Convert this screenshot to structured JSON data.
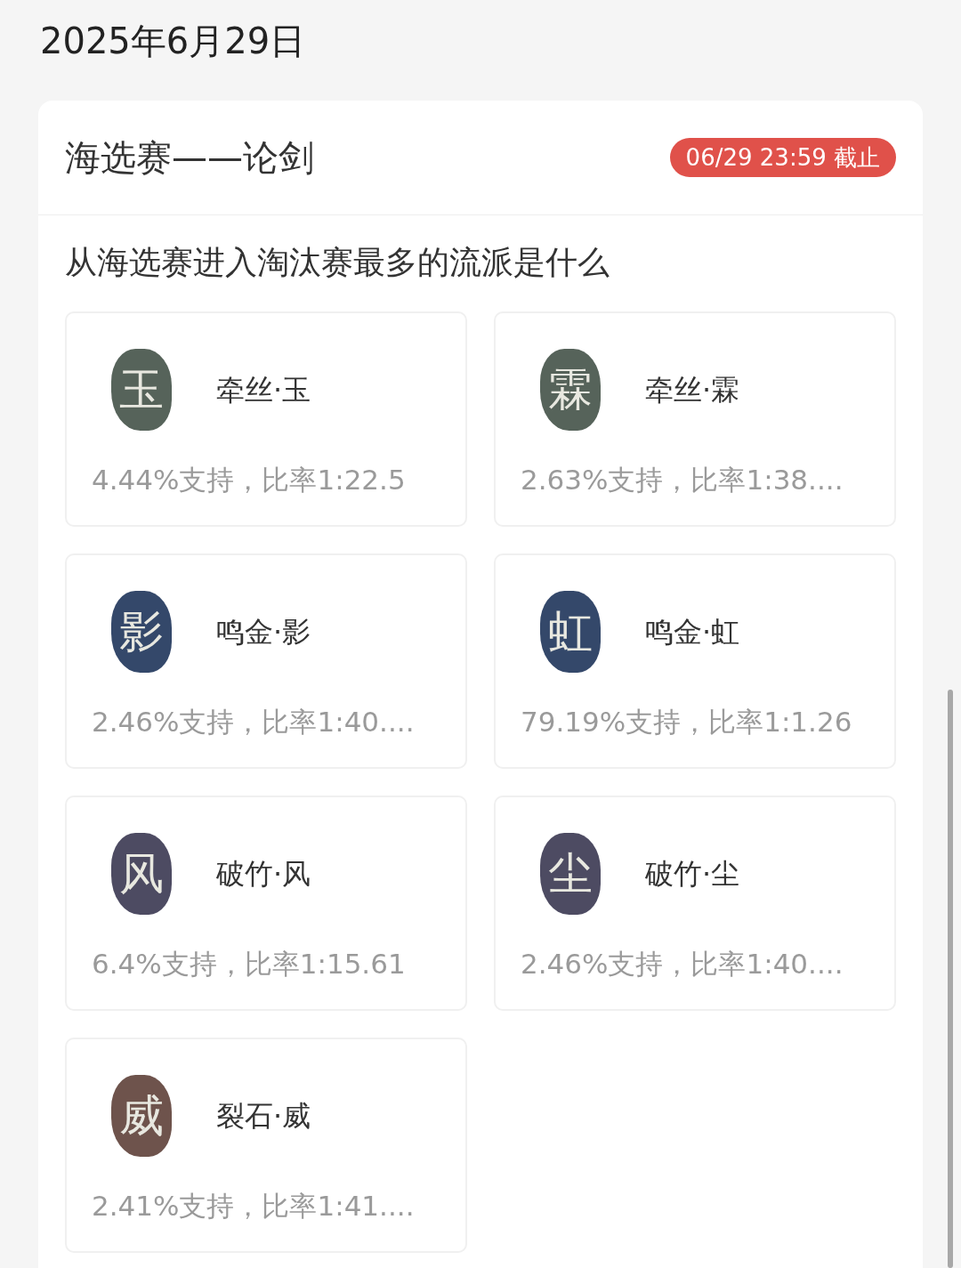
{
  "date": "2025年6月29日",
  "card": {
    "title": "海选赛——论剑",
    "deadline": "06/29 23:59 截止",
    "question": "从海选赛进入淘汰赛最多的流派是什么",
    "options": [
      {
        "seal": "玉",
        "color": "#56635a",
        "name": "牵丝·玉",
        "stat": "4.44%支持，比率1:22.5"
      },
      {
        "seal": "霖",
        "color": "#56635a",
        "name": "牵丝·霖",
        "stat": "2.63%支持，比率1:38...."
      },
      {
        "seal": "影",
        "color": "#34486a",
        "name": "鸣金·影",
        "stat": "2.46%支持，比率1:40...."
      },
      {
        "seal": "虹",
        "color": "#34486a",
        "name": "鸣金·虹",
        "stat": "79.19%支持，比率1:1.26"
      },
      {
        "seal": "风",
        "color": "#4d4b62",
        "name": "破竹·风",
        "stat": "6.4%支持，比率1:15.61"
      },
      {
        "seal": "尘",
        "color": "#4d4b62",
        "name": "破竹·尘",
        "stat": "2.46%支持，比率1:40...."
      },
      {
        "seal": "威",
        "color": "#6e534c",
        "name": "裂石·威",
        "stat": "2.41%支持，比率1:41...."
      }
    ]
  }
}
